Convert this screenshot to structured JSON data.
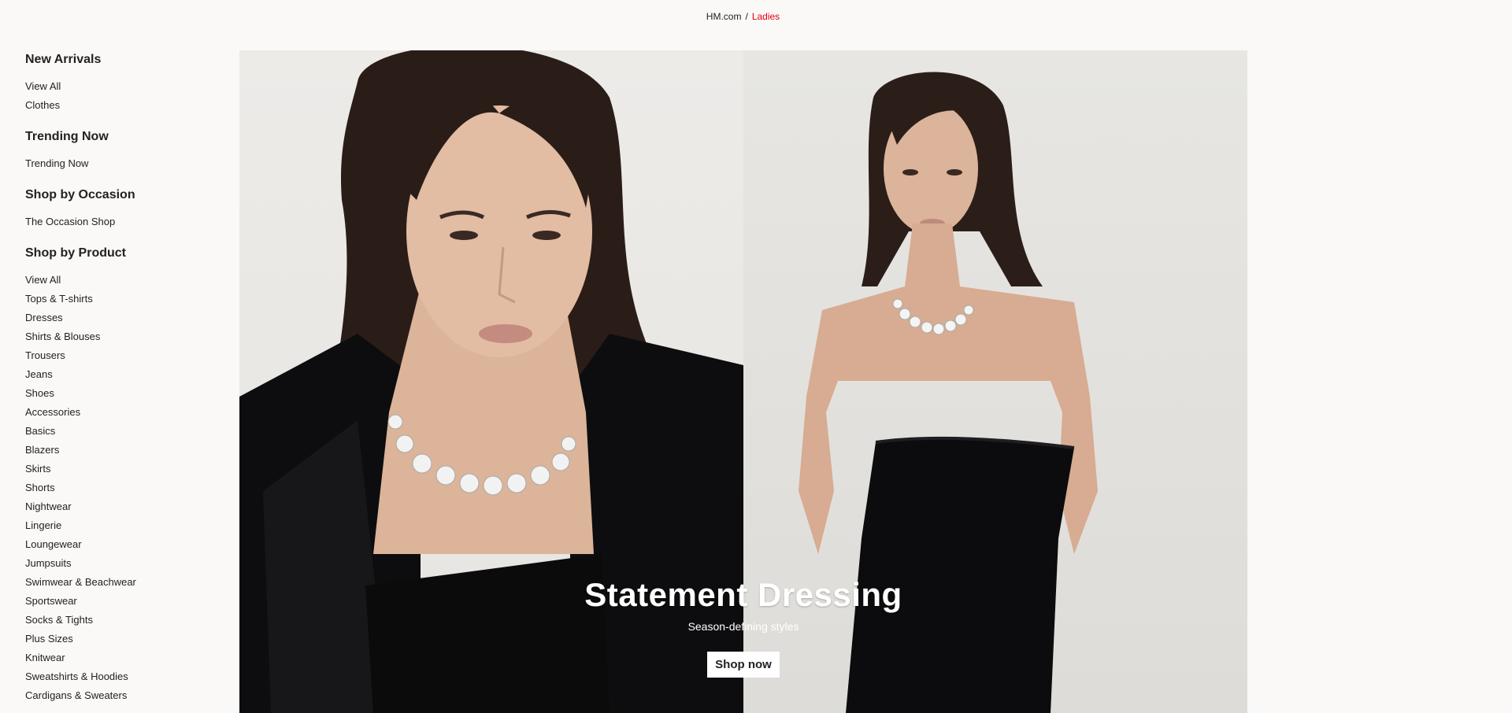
{
  "breadcrumb": {
    "home": "HM.com",
    "separator": "/",
    "current": "Ladies"
  },
  "sidebar": {
    "sections": [
      {
        "heading": "New Arrivals",
        "items": [
          "View All",
          "Clothes"
        ]
      },
      {
        "heading": "Trending Now",
        "items": [
          "Trending Now"
        ]
      },
      {
        "heading": "Shop by Occasion",
        "items": [
          "The Occasion Shop"
        ]
      },
      {
        "heading": "Shop by Product",
        "items": [
          "View All",
          "Tops & T-shirts",
          "Dresses",
          "Shirts & Blouses",
          "Trousers",
          "Jeans",
          "Shoes",
          "Accessories",
          "Basics",
          "Blazers",
          "Skirts",
          "Shorts",
          "Nightwear",
          "Lingerie",
          "Loungewear",
          "Jumpsuits",
          "Swimwear & Beachwear",
          "Sportswear",
          "Socks & Tights",
          "Plus Sizes",
          "Knitwear",
          "Sweatshirts & Hoodies",
          "Cardigans & Sweaters"
        ]
      }
    ]
  },
  "hero": {
    "title": "Statement Dressing",
    "subtitle": "Season-defining styles",
    "cta": "Shop now"
  },
  "colors": {
    "accent": "#e50010",
    "background": "#faf9f8",
    "text": "#222222"
  }
}
